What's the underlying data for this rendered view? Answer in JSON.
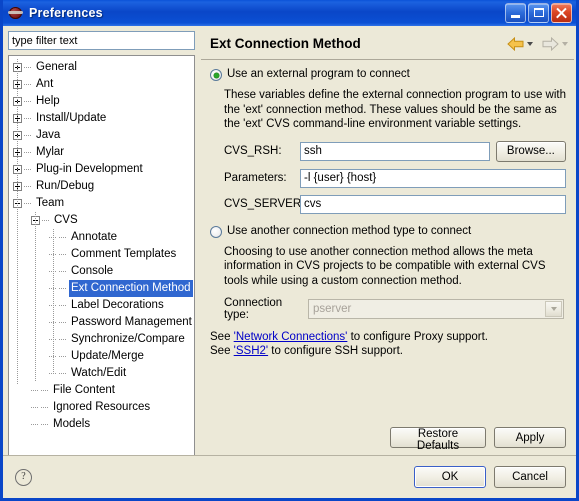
{
  "window": {
    "title": "Preferences",
    "icon": "eclipse-sphere-icon",
    "minimize_label": "Minimize",
    "maximize_label": "Maximize",
    "close_label": "Close",
    "accent_color": "#0a46c8",
    "panel_color": "#ece9d8"
  },
  "filter": {
    "value": "type filter text",
    "placeholder": "type filter text"
  },
  "tree": {
    "items": [
      {
        "label": "General",
        "depth": 0,
        "toggle": "plus",
        "selected": false
      },
      {
        "label": "Ant",
        "depth": 0,
        "toggle": "plus",
        "selected": false
      },
      {
        "label": "Help",
        "depth": 0,
        "toggle": "plus",
        "selected": false
      },
      {
        "label": "Install/Update",
        "depth": 0,
        "toggle": "plus",
        "selected": false
      },
      {
        "label": "Java",
        "depth": 0,
        "toggle": "plus",
        "selected": false
      },
      {
        "label": "Mylar",
        "depth": 0,
        "toggle": "plus",
        "selected": false
      },
      {
        "label": "Plug-in Development",
        "depth": 0,
        "toggle": "plus",
        "selected": false
      },
      {
        "label": "Run/Debug",
        "depth": 0,
        "toggle": "plus",
        "selected": false
      },
      {
        "label": "Team",
        "depth": 0,
        "toggle": "minus",
        "selected": false
      },
      {
        "label": "CVS",
        "depth": 1,
        "toggle": "minus",
        "selected": false
      },
      {
        "label": "Annotate",
        "depth": 2,
        "toggle": "none",
        "selected": false
      },
      {
        "label": "Comment Templates",
        "depth": 2,
        "toggle": "none",
        "selected": false
      },
      {
        "label": "Console",
        "depth": 2,
        "toggle": "none",
        "selected": false
      },
      {
        "label": "Ext Connection Method",
        "depth": 2,
        "toggle": "none",
        "selected": true
      },
      {
        "label": "Label Decorations",
        "depth": 2,
        "toggle": "none",
        "selected": false
      },
      {
        "label": "Password Management",
        "depth": 2,
        "toggle": "none",
        "selected": false
      },
      {
        "label": "Synchronize/Compare",
        "depth": 2,
        "toggle": "none",
        "selected": false
      },
      {
        "label": "Update/Merge",
        "depth": 2,
        "toggle": "none",
        "selected": false
      },
      {
        "label": "Watch/Edit",
        "depth": 2,
        "toggle": "none",
        "selected": false
      },
      {
        "label": "File Content",
        "depth": 1,
        "toggle": "none",
        "selected": false
      },
      {
        "label": "Ignored Resources",
        "depth": 1,
        "toggle": "none",
        "selected": false
      },
      {
        "label": "Models",
        "depth": 1,
        "toggle": "none",
        "selected": false
      }
    ],
    "selection_color": "#3067d0"
  },
  "page": {
    "title": "Ext Connection Method",
    "nav": {
      "back_icon": "back-arrow-icon",
      "back_enabled": true,
      "back_color": "#f0b429",
      "forward_icon": "forward-arrow-icon",
      "forward_enabled": false,
      "forward_color": "#c9c5b8"
    },
    "external": {
      "radio_label": "Use an external program to connect",
      "selected": true,
      "description": "These variables define the external connection program to use with the 'ext' connection method. These values should be the same as the 'ext' CVS command-line environment variable settings.",
      "fields": [
        {
          "label": "CVS_RSH:",
          "value": "ssh"
        },
        {
          "label": "Parameters:",
          "value": "-l {user} {host}"
        },
        {
          "label": "CVS_SERVER:",
          "value": "cvs"
        }
      ],
      "browse_label": "Browse..."
    },
    "other": {
      "radio_label": "Use another connection method type to connect",
      "selected": false,
      "description": "Choosing to use another connection method allows the meta information in CVS projects to be compatible with external CVS tools while using a custom connection method.",
      "connection_type_label": "Connection type:",
      "connection_type_value": "pserver",
      "connection_type_enabled": false
    },
    "links": [
      {
        "prefix": "See ",
        "link": "'Network Connections'",
        "suffix": " to configure Proxy support."
      },
      {
        "prefix": "See ",
        "link": "'SSH2'",
        "suffix": " to configure SSH support."
      }
    ],
    "restore_defaults_label": "Restore Defaults",
    "apply_label": "Apply"
  },
  "footer": {
    "help_icon": "help-question-icon",
    "ok_label": "OK",
    "cancel_label": "Cancel"
  }
}
